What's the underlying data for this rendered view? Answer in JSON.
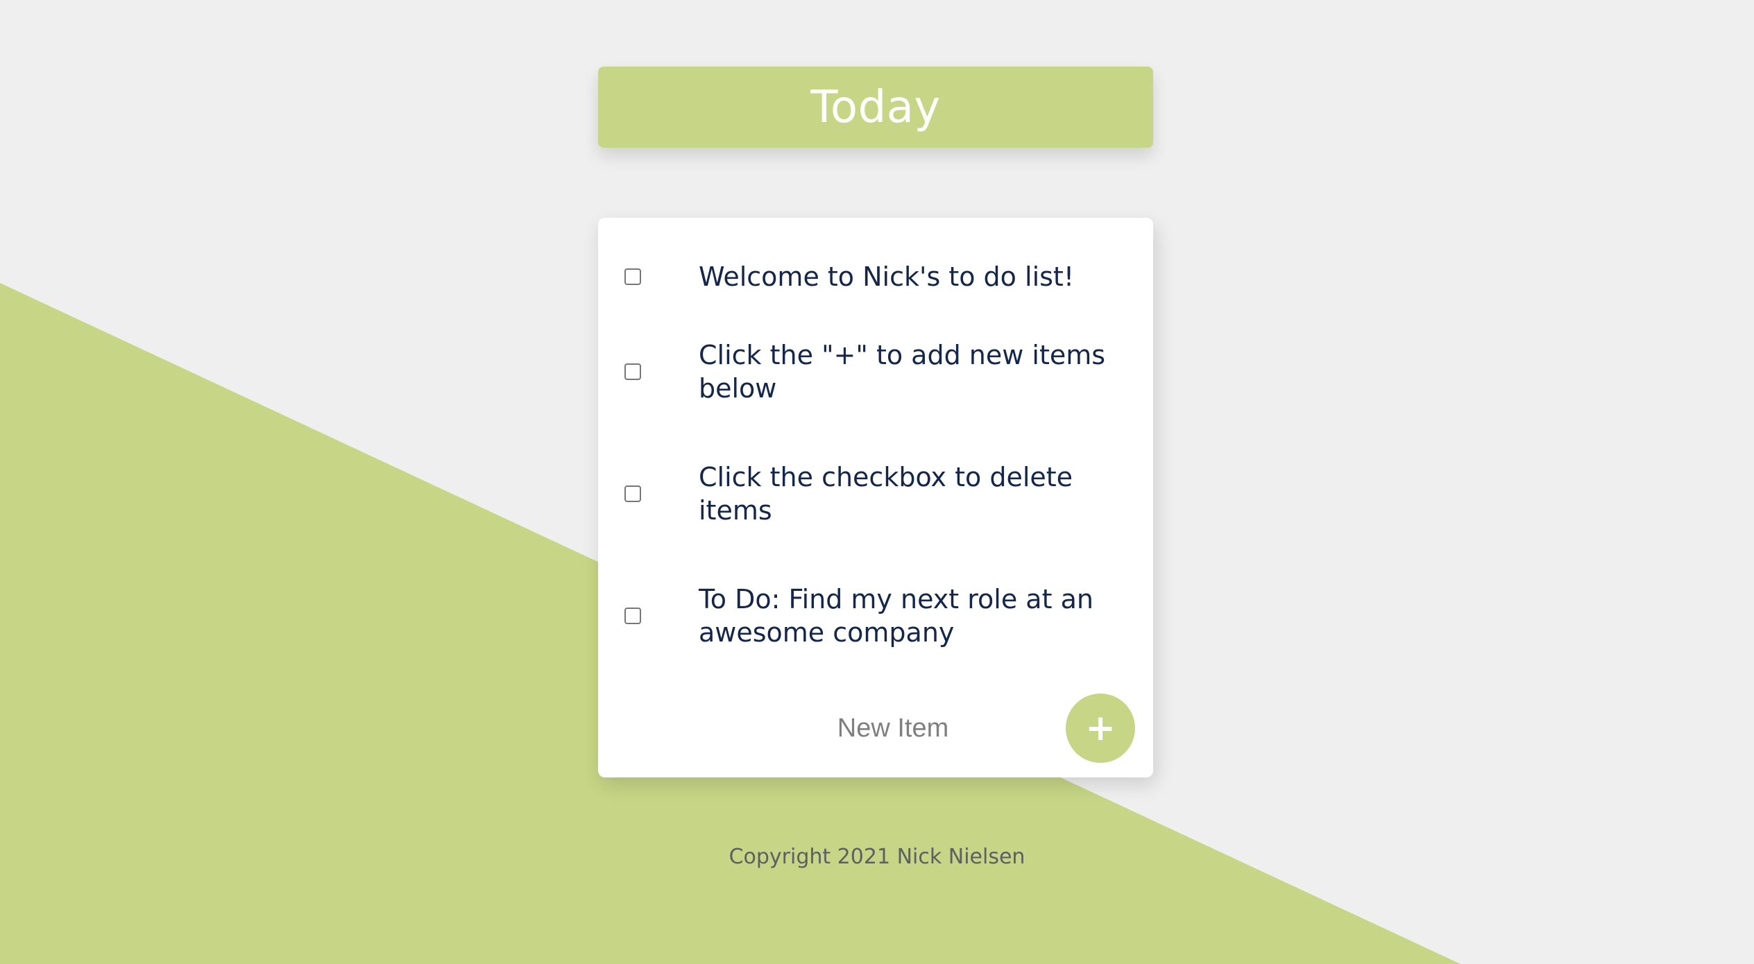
{
  "header": {
    "title": "Today"
  },
  "list": {
    "items": [
      {
        "label": "Welcome to Nick's to do list!",
        "checked": false
      },
      {
        "label": "Click the \"+\" to add new items below",
        "checked": false
      },
      {
        "label": "Click the checkbox to delete items",
        "checked": false
      },
      {
        "label": "To Do: Find my next role at an awesome company",
        "checked": false
      }
    ],
    "new_item_placeholder": "New Item",
    "add_button_label": "+"
  },
  "footer": {
    "copyright": "Copyright 2021 Nick Nielsen"
  },
  "colors": {
    "accent": "#c7d586",
    "background": "#efefef",
    "text": "#14264a"
  },
  "icons": {
    "add": "plus-icon"
  }
}
